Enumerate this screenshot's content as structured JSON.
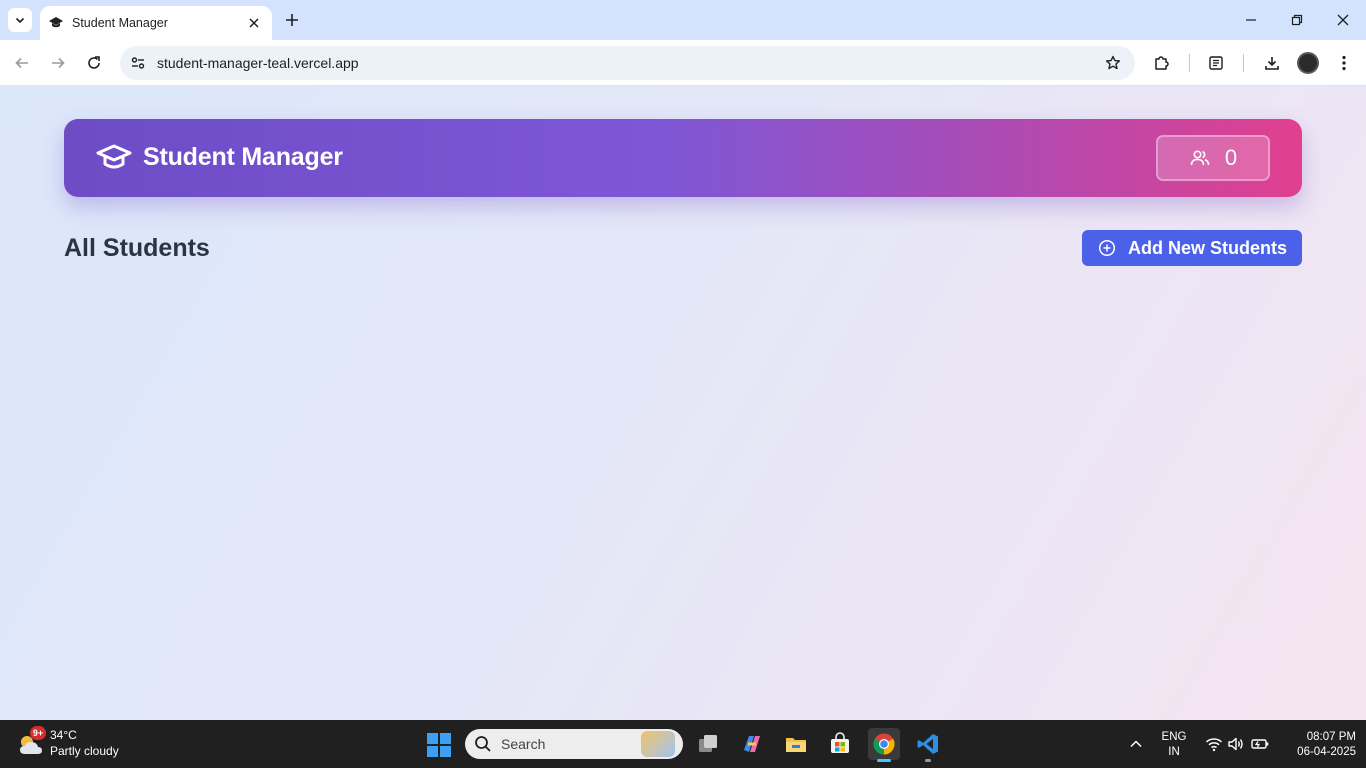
{
  "browser": {
    "tab_title": "Student Manager",
    "url": "student-manager-teal.vercel.app"
  },
  "app": {
    "title": "Student Manager",
    "student_count": "0",
    "section_title": "All Students",
    "add_button_label": "Add New Students",
    "colors": {
      "header_start": "#6d4cc6",
      "header_end": "#e1408f",
      "add_button": "#4b62e8",
      "section_title": "#2b3442"
    }
  },
  "taskbar": {
    "weather_badge": "9+",
    "temperature": "34°C",
    "condition": "Partly cloudy",
    "search_placeholder": "Search",
    "language_line1": "ENG",
    "language_line2": "IN",
    "time": "08:07 PM",
    "date": "06-04-2025"
  },
  "icons": {
    "tab_favicon": "graduation-cap-icon",
    "header": "graduation-cap-icon",
    "counter": "users-icon",
    "add_button": "plus-circle-icon"
  }
}
